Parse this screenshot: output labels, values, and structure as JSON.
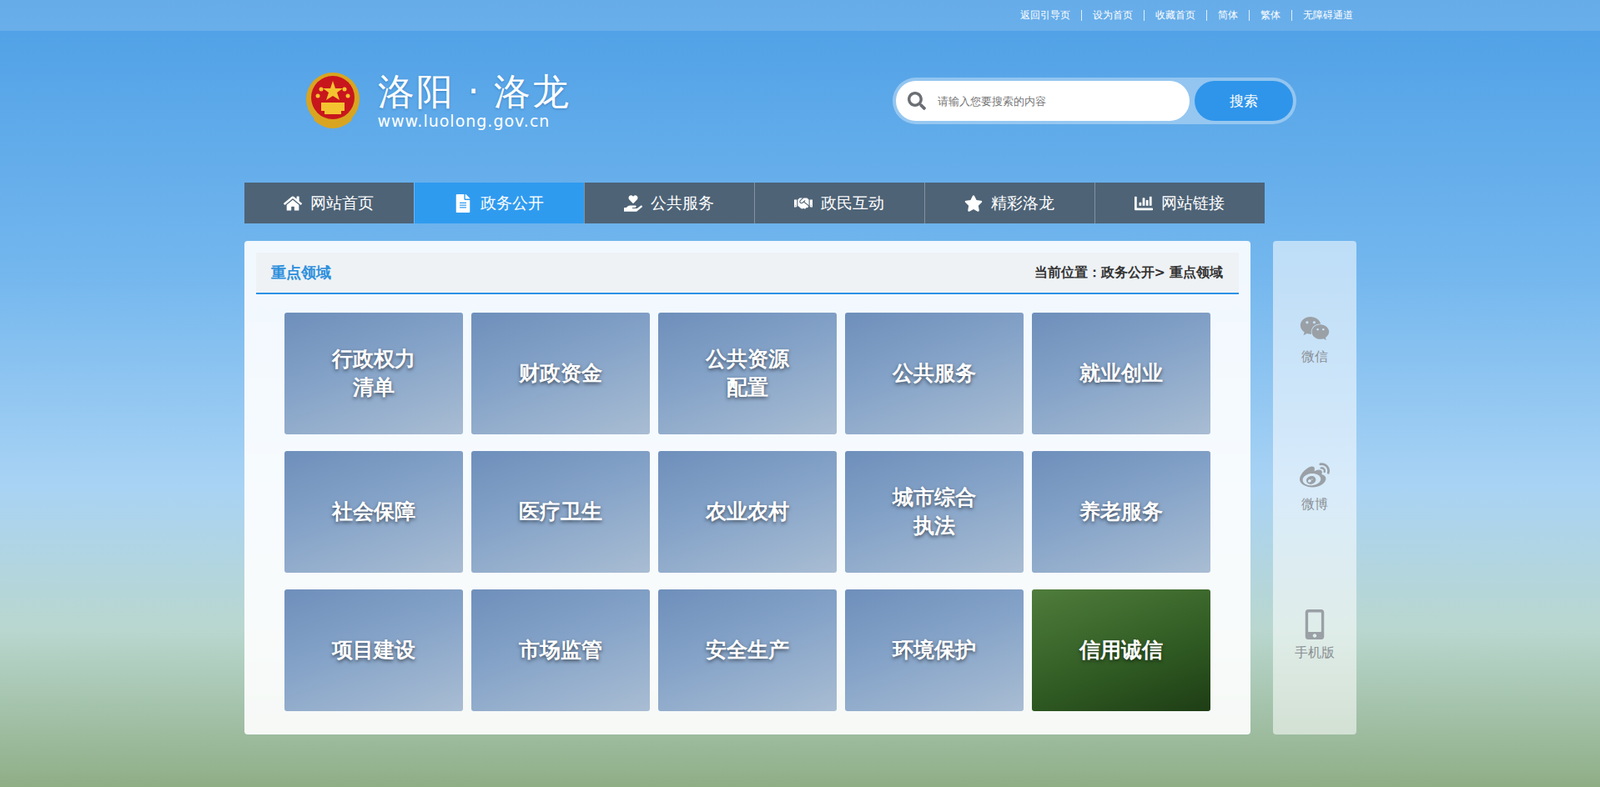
{
  "top_bar": {
    "links": [
      "返回引导页",
      "设为首页",
      "收藏首页",
      "简体",
      "繁体",
      "无障碍通道"
    ]
  },
  "logo": {
    "title": "洛阳 · 洛龙",
    "url": "www.luolong.gov.cn"
  },
  "search": {
    "placeholder": "请输入您要搜索的内容",
    "button": "搜索"
  },
  "nav": [
    {
      "label": "网站首页",
      "selected": false
    },
    {
      "label": "政务公开",
      "selected": true
    },
    {
      "label": "公共服务",
      "selected": false
    },
    {
      "label": "政民互动",
      "selected": false
    },
    {
      "label": "精彩洛龙",
      "selected": false
    },
    {
      "label": "网站链接",
      "selected": false
    }
  ],
  "section": {
    "title": "重点领域",
    "breadcrumb": "当前位置：政务公开> 重点领域"
  },
  "tiles": [
    "行政权力清单",
    "财政资金",
    "公共资源配置",
    "公共服务",
    "就业创业",
    "社会保障",
    "医疗卫生",
    "农业农村",
    "城市综合执法",
    "养老服务",
    "项目建设",
    "市场监管",
    "安全生产",
    "环境保护",
    "信用诚信"
  ],
  "side": [
    "微信",
    "微博",
    "手机版"
  ]
}
